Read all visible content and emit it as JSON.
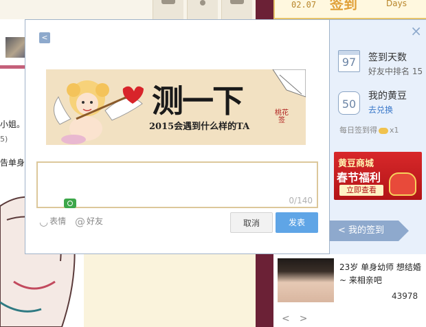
{
  "header": {
    "date": "02.07",
    "big_text": "签到",
    "days_label": "Days"
  },
  "background": {
    "text_lines": [
      "小姐。",
      "5)",
      "告单身"
    ],
    "profile_text": "23岁 单身幼师 想结婚~ 来相亲吧",
    "view_count": "43978",
    "nav_prev": "<",
    "nav_next": ">"
  },
  "modal": {
    "back_label": "<",
    "banner": {
      "title": "测一下",
      "subtitle": "2015会遇到什么样的TA",
      "seal": "桃花签"
    },
    "input": {
      "value": "",
      "placeholder": "",
      "counter": "0/140"
    },
    "tools": {
      "emoji_label": "表情",
      "friend_label": "好友"
    },
    "cancel_label": "取消",
    "submit_label": "发表"
  },
  "panel": {
    "close_label": "×",
    "days": {
      "value": "97",
      "label": "签到天数",
      "rank_text": "好友中排名 15"
    },
    "beans": {
      "value": "50",
      "label": "我的黄豆",
      "link": "去兑换"
    },
    "daily_reward": {
      "prefix": "每日签到得",
      "suffix": "x1"
    },
    "ad": {
      "line1": "黄豆商城",
      "line2": "春节福利",
      "button": "立即查看"
    },
    "my_sign_label": "我的签到"
  }
}
